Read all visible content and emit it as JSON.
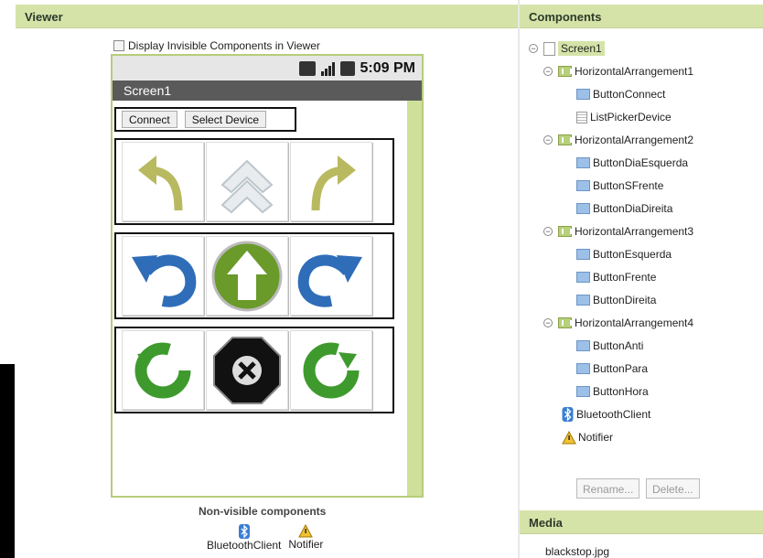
{
  "viewer": {
    "title": "Viewer",
    "display_invisible_label": "Display Invisible Components in Viewer",
    "phone": {
      "time": "5:09 PM",
      "screen_title": "Screen1",
      "buttons": [
        "Connect",
        "Select Device"
      ]
    },
    "nonvisible_title": "Non-visible components",
    "nonvisible": [
      "BluetoothClient",
      "Notifier"
    ]
  },
  "components": {
    "title": "Components",
    "tree": [
      {
        "label": "Screen1"
      },
      {
        "label": "HorizontalArrangement1"
      },
      {
        "label": "ButtonConnect"
      },
      {
        "label": "ListPickerDevice"
      },
      {
        "label": "HorizontalArrangement2"
      },
      {
        "label": "ButtonDiaEsquerda"
      },
      {
        "label": "ButtonSFrente"
      },
      {
        "label": "ButtonDiaDireita"
      },
      {
        "label": "HorizontalArrangement3"
      },
      {
        "label": "ButtonEsquerda"
      },
      {
        "label": "ButtonFrente"
      },
      {
        "label": "ButtonDireita"
      },
      {
        "label": "HorizontalArrangement4"
      },
      {
        "label": "ButtonAnti"
      },
      {
        "label": "ButtonPara"
      },
      {
        "label": "ButtonHora"
      },
      {
        "label": "BluetoothClient"
      },
      {
        "label": "Notifier"
      }
    ],
    "rename_label": "Rename...",
    "delete_label": "Delete..."
  },
  "media": {
    "title": "Media",
    "files": [
      "blackstop.jpg"
    ]
  }
}
